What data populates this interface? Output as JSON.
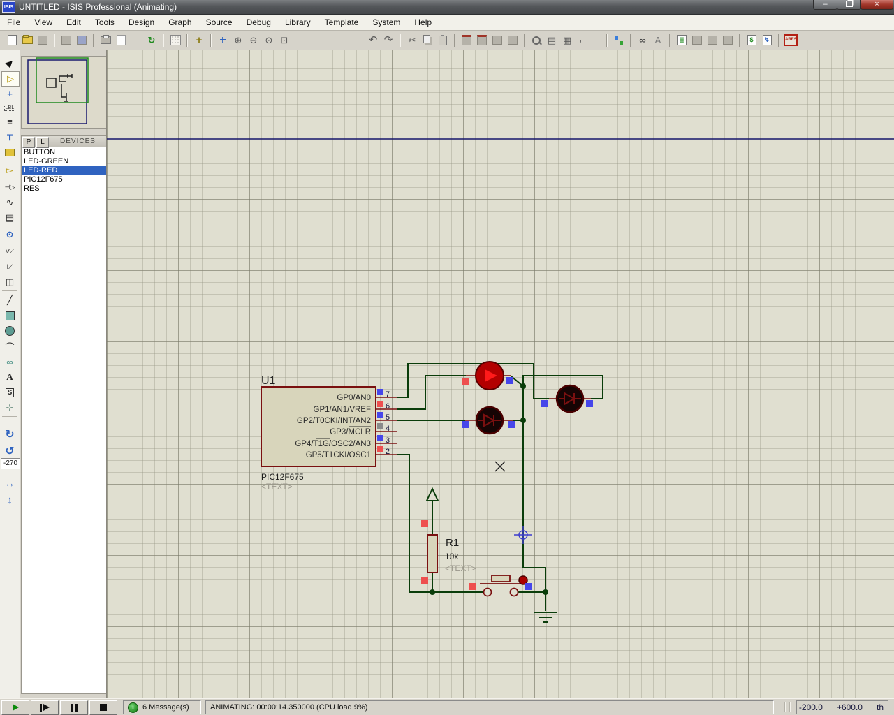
{
  "window": {
    "title": "UNTITLED - ISIS Professional (Animating)",
    "logo_text": "ISIS",
    "controls": {
      "minimize": "–",
      "close": "×"
    }
  },
  "menu": {
    "items": [
      "File",
      "View",
      "Edit",
      "Tools",
      "Design",
      "Graph",
      "Source",
      "Debug",
      "Library",
      "Template",
      "System",
      "Help"
    ]
  },
  "icons": {
    "redraw": "↻",
    "origin": "+",
    "pan": "+",
    "zoom_in": "⊕",
    "zoom_out": "⊖",
    "zoom_all": "⊙",
    "zoom_area": "⊡",
    "undo": "↶",
    "redo": "↷",
    "cut": "✂",
    "block_rotate": "↻",
    "block_move": "▦",
    "block_delete": "▨",
    "make_device": "▤",
    "packaging": "▦",
    "decompose": "⌐",
    "search": "∞",
    "property": "A",
    "goto_sheet": "→",
    "remove_sheet": "✕",
    "bom": "$",
    "erc": "↯",
    "ares": "ARES",
    "selector": "▶",
    "component": "▷",
    "junction": "+",
    "wire_label": "LBL",
    "script": "≡",
    "bus": "┳",
    "subcircuit": "▭",
    "terminal": "▻",
    "device_pin": "⊣▷",
    "graph": "∿",
    "tape": "▤",
    "generator": "⊙",
    "vprobe": "V⟋",
    "iprobe": "I⟋",
    "instrument": "◫",
    "line2d": "╱",
    "arc2d": "⌒",
    "path2d": "∞",
    "text2d": "A",
    "symbol2d": "S",
    "marker2d": "⊹",
    "rotate_cw": "↻",
    "rotate_ccw": "↺",
    "mirror_h": "↔",
    "mirror_v": "↕",
    "info": "i"
  },
  "sidebar": {
    "rotation_angle": "-270"
  },
  "devices_panel": {
    "pick_button": "P",
    "library_button": "L",
    "header": "DEVICES",
    "items": [
      "BUTTON",
      "LED-GREEN",
      "LED-RED",
      "PIC12F675",
      "RES"
    ],
    "selected": "LED-RED"
  },
  "schematic": {
    "chip": {
      "ref": "U1",
      "device": "PIC12F675",
      "text_placeholder": "<TEXT>",
      "pins": [
        {
          "num": "7",
          "label": "GP0/AN0",
          "state": "blue"
        },
        {
          "num": "6",
          "label": "GP1/AN1/VREF",
          "state": "red"
        },
        {
          "num": "5",
          "label": "GP2/T0CKI/INT/AN2",
          "state": "blue"
        },
        {
          "num": "4",
          "label": "GP3/MCLR",
          "state": "gray"
        },
        {
          "num": "3",
          "label": "GP4/T1G/OSC2/AN3",
          "state": "blue"
        },
        {
          "num": "2",
          "label": "GP5/T1CKI/OSC1",
          "state": "red"
        }
      ]
    },
    "resistor": {
      "ref": "R1",
      "value": "10k",
      "text_placeholder": "<TEXT>"
    },
    "leds": [
      {
        "name": "led-top",
        "state": "lit"
      },
      {
        "name": "led-right",
        "state": "off"
      },
      {
        "name": "led-middle",
        "state": "off"
      }
    ],
    "colors": {
      "wire": "#0a3d0a",
      "component_outline": "#7a1010",
      "led_lit_body": "#b30000",
      "led_lit_arrow": "#ff1a1a",
      "led_off_body": "#160404",
      "indicator_red": "#ee4f4f",
      "indicator_blue": "#4646ea",
      "indicator_gray": "#8a8a8a"
    }
  },
  "statusbar": {
    "messages": "6 Message(s)",
    "animating": "ANIMATING: 00:00:14.350000 (CPU load 9%)",
    "coord_x": "-200.0",
    "coord_y": "+600.0",
    "coord_units": "th"
  }
}
